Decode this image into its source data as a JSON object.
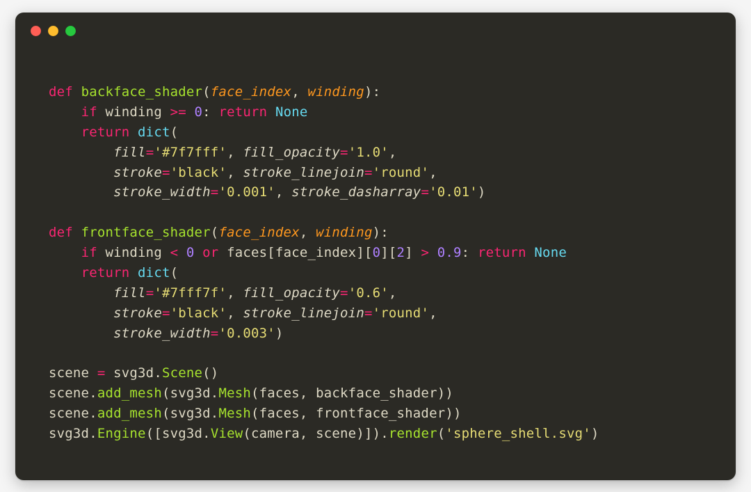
{
  "code": {
    "t1": "def ",
    "t2": "backface_shader",
    "t3": "(",
    "t4": "face_index",
    "t5": ", ",
    "t6": "winding",
    "t7": "):",
    "t8": "    ",
    "t9": "if ",
    "t10": "winding ",
    "t11": ">=",
    "t12": " ",
    "t13": "0",
    "t14": ": ",
    "t15": "return ",
    "t16": "None",
    "t17": "    ",
    "t18": "return ",
    "t19": "dict",
    "t20": "(",
    "t21": "        ",
    "t22": "fill",
    "t23": "=",
    "t24": "'#7f7fff'",
    "t25": ", ",
    "t26": "fill_opacity",
    "t27": "=",
    "t28": "'1.0'",
    "t29": ",",
    "t30": "        ",
    "t31": "stroke",
    "t32": "=",
    "t33": "'black'",
    "t34": ", ",
    "t35": "stroke_linejoin",
    "t36": "=",
    "t37": "'round'",
    "t38": ",",
    "t39": "        ",
    "t40": "stroke_width",
    "t41": "=",
    "t42": "'0.001'",
    "t43": ", ",
    "t44": "stroke_dasharray",
    "t45": "=",
    "t46": "'0.01'",
    "t47": ")",
    "blank1": "",
    "t48": "def ",
    "t49": "frontface_shader",
    "t50": "(",
    "t51": "face_index",
    "t52": ", ",
    "t53": "winding",
    "t54": "):",
    "t55": "    ",
    "t56": "if ",
    "t57": "winding ",
    "t58": "<",
    "t59": " ",
    "t60": "0",
    "t61": " ",
    "t62": "or ",
    "t63": "faces[face_index][",
    "t64": "0",
    "t65": "][",
    "t66": "2",
    "t67": "] ",
    "t68": ">",
    "t69": " ",
    "t70": "0.9",
    "t71": ": ",
    "t72": "return ",
    "t73": "None",
    "t74": "    ",
    "t75": "return ",
    "t76": "dict",
    "t77": "(",
    "t78": "        ",
    "t79": "fill",
    "t80": "=",
    "t81": "'#7fff7f'",
    "t82": ", ",
    "t83": "fill_opacity",
    "t84": "=",
    "t85": "'0.6'",
    "t86": ",",
    "t87": "        ",
    "t88": "stroke",
    "t89": "=",
    "t90": "'black'",
    "t91": ", ",
    "t92": "stroke_linejoin",
    "t93": "=",
    "t94": "'round'",
    "t95": ",",
    "t96": "        ",
    "t97": "stroke_width",
    "t98": "=",
    "t99": "'0.003'",
    "t100": ")",
    "blank2": "",
    "t101": "scene ",
    "t102": "=",
    "t103": " svg3d.",
    "t104": "Scene",
    "t105": "()",
    "t106": "scene.",
    "t107": "add_mesh",
    "t108": "(svg3d.",
    "t109": "Mesh",
    "t110": "(faces, backface_shader))",
    "t111": "scene.",
    "t112": "add_mesh",
    "t113": "(svg3d.",
    "t114": "Mesh",
    "t115": "(faces, frontface_shader))",
    "t116": "svg3d.",
    "t117": "Engine",
    "t118": "([svg3d.",
    "t119": "View",
    "t120": "(camera, scene)]).",
    "t121": "render",
    "t122": "(",
    "t123": "'sphere_shell.svg'",
    "t124": ")"
  }
}
